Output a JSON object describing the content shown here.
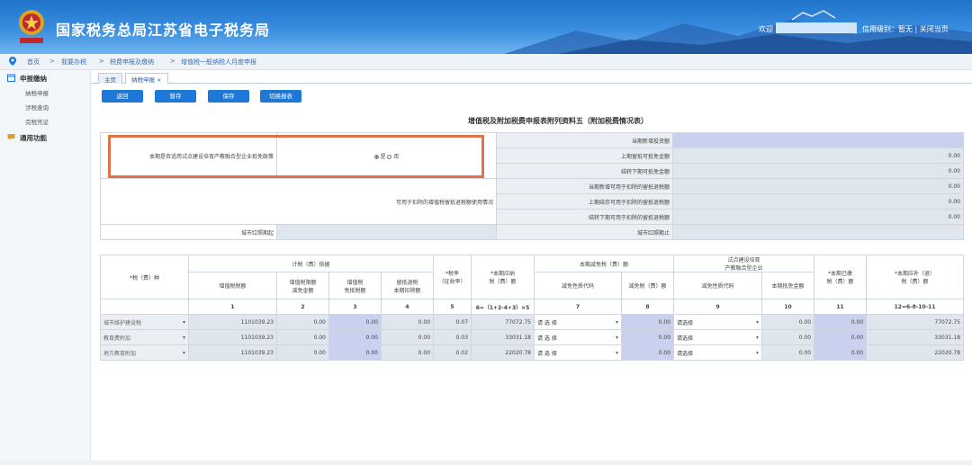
{
  "header": {
    "site_title": "国家税务总局江苏省电子税务局",
    "welcome": "欢迎",
    "credit_rating": "信用级别：暂无",
    "separator": "|",
    "close_link": "关闭当页"
  },
  "breadcrumb": {
    "items": [
      "首页",
      "我要办税",
      "税费申报及缴纳",
      "增值税一般纳税人月度申报"
    ],
    "arrow": ">"
  },
  "sidebar": {
    "groups": [
      {
        "label": "申报缴纳",
        "items": [
          "纳税申报",
          "涉税查询",
          "完税凭证"
        ]
      },
      {
        "label": "通用功能",
        "items": []
      }
    ]
  },
  "tabs": [
    {
      "label": "主页",
      "active": false
    },
    {
      "label": "纳税申报 ×",
      "active": true
    }
  ],
  "toolbar": {
    "back": "返回",
    "stage": "暂存",
    "save": "保存",
    "switch": "切换报表"
  },
  "form": {
    "title": "增值税及附加税费申报表附列资料五（附加税费情况表）",
    "policy_question": "本期是否适用试点建设培育产教融合型企业抵免政策",
    "option_yes": "是",
    "option_no": "否",
    "selected": "是",
    "retained_tax_usage": "可用于扣除的增值税留抵退税额使用情况",
    "right_rows": [
      {
        "label": "当期新增投资额",
        "value": ""
      },
      {
        "label": "上期留抵可抵免金额",
        "value": "0.00"
      },
      {
        "label": "结转下期可抵免金额",
        "value": "0.00"
      },
      {
        "label": "当期新增可用于扣除的留抵退税额",
        "value": "0.00"
      },
      {
        "label": "上期结存可用于扣除的留抵退税额",
        "value": "0.00"
      },
      {
        "label": "结转下期可用于扣除的留抵退税额",
        "value": "0.00"
      }
    ],
    "period_start_label": "城市红照期起",
    "period_end_label": "城市红照期止"
  },
  "tax_table": {
    "headers": {
      "tax_type": "*税（费）种",
      "basis": "计税（费）依据",
      "vat_amount": "增值税税额",
      "vat_exempt_l1": "增值税限额",
      "vat_exempt_l2": "减免金额",
      "vat_free_l1": "增值税",
      "vat_free_l2": "免抵税额",
      "retained_l1": "留抵退税",
      "retained_l2": "本期扣除额",
      "rate_l1": "*税率",
      "rate_l2": "（征收率）",
      "payable_l1": "*本期应纳",
      "payable_l2": "税（费）额",
      "relief": "本期减免税（费）额",
      "relief_code": "减免性质代码",
      "relief_amount": "减免税（费）额",
      "pilot_l1": "试点建设培育",
      "pilot_l2": "产教融合型企业",
      "pilot_code": "减免性质代码",
      "pilot_amount": "本期抵免金额",
      "paid_l1": "*本期已缴",
      "paid_l2": "税（费）额",
      "due_l1": "*本期应补（退）",
      "due_l2": "税（费）额"
    },
    "col_numbers": [
      "1",
      "2",
      "3",
      "4",
      "5",
      "6=（1+2-4+3）×5",
      "7",
      "8",
      "9",
      "10",
      "11",
      "12=6-8-10-11"
    ],
    "rows": [
      {
        "tax_type": "城市维护建设税",
        "vat": "1101039.23",
        "c2": "0.00",
        "c3": "0.00",
        "c4": "0.00",
        "rate": "0.07",
        "payable": "77072.75",
        "relief_code": "请 选 择",
        "relief_amt": "0.00",
        "pilot_code": "请选择",
        "pilot_amt": "0.00",
        "paid": "0.00",
        "due": "77072.75"
      },
      {
        "tax_type": "教育费附加",
        "vat": "1101039.23",
        "c2": "0.00",
        "c3": "0.00",
        "c4": "0.00",
        "rate": "0.03",
        "payable": "33031.18",
        "relief_code": "请 选 择",
        "relief_amt": "0.00",
        "pilot_code": "请选择",
        "pilot_amt": "0.00",
        "paid": "0.00",
        "due": "33031.18"
      },
      {
        "tax_type": "地方教育附加",
        "vat": "1101039.23",
        "c2": "0.00",
        "c3": "0.00",
        "c4": "0.00",
        "rate": "0.02",
        "payable": "22020.78",
        "relief_code": "请 选 择",
        "relief_amt": "0.00",
        "pilot_code": "请选择",
        "pilot_amt": "0.00",
        "paid": "0.00",
        "due": "22020.78"
      }
    ]
  },
  "colors": {
    "banner": "#1f73c9",
    "button": "#1e78d7",
    "highlight_box": "#e07346",
    "input_blue": "#c9d1ef"
  }
}
